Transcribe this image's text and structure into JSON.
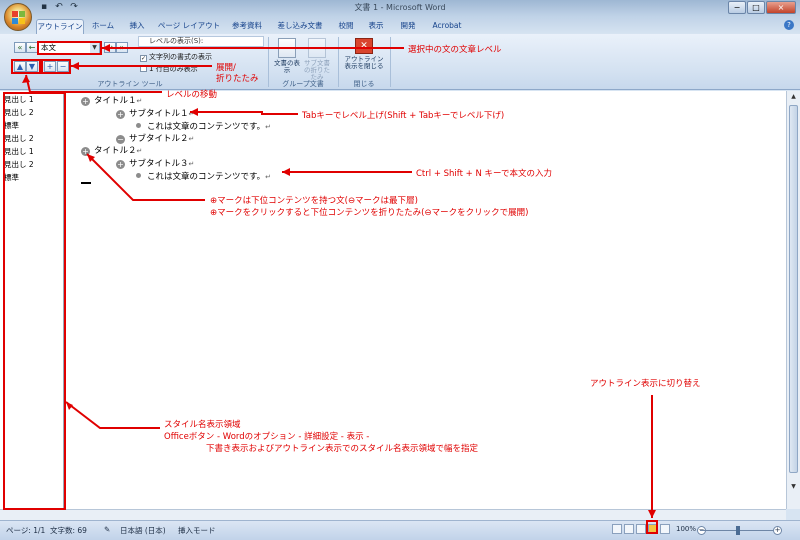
{
  "window": {
    "title": "文書 1 - Microsoft Word",
    "controls": [
      "−",
      "□",
      "×"
    ]
  },
  "quick_access": [
    "save-icon",
    "undo-icon",
    "redo-icon"
  ],
  "tabs": [
    {
      "label": "アウトライン",
      "active": true
    },
    {
      "label": "ホーム"
    },
    {
      "label": "挿入"
    },
    {
      "label": "ページ レイアウト"
    },
    {
      "label": "参考資料"
    },
    {
      "label": "差し込み文書"
    },
    {
      "label": "校閲"
    },
    {
      "label": "表示"
    },
    {
      "label": "開発"
    },
    {
      "label": "Acrobat"
    }
  ],
  "ribbon": {
    "level_value": "本文",
    "show_level": "レベルの表示(S):",
    "show_text_formatting": "文字列の書式の表示",
    "show_first_line_only": "1 行目のみ表示",
    "group_outline_tools": "アウトライン ツール",
    "btn_show_document": "文書の表示",
    "btn_collapse_subdocs": "サブ文書の折りたたみ",
    "group_master_document": "グループ文書",
    "btn_close_outline": "アウトライン表示を閉じる",
    "group_close": "閉じる"
  },
  "style_pane": [
    "見出し 1",
    "見出し 2",
    "標準",
    "見出し 2",
    "見出し 1",
    "見出し 2",
    "標準"
  ],
  "outline": {
    "title1": "タイトル１",
    "subtitle1": "サブタイトル１",
    "body1": "これは文章のコンテンツです。",
    "subtitle2": "サブタイトル２",
    "title2": "タイトル２",
    "subtitle3": "サブタイトル３",
    "body2": "これは文章のコンテンツです。",
    "para_mark": "↵"
  },
  "status": {
    "page": "ページ: 1/1",
    "words": "文字数: 69",
    "language": "日本語 (日本)",
    "mode": "挿入モード",
    "zoom": "100%"
  },
  "annotations": {
    "level_of_selected": "選択中の文の文章レベル",
    "expand_collapse": "展開/\n折りたたみ",
    "expand_line1": "展開/",
    "expand_line2": "折りたたみ",
    "move_level": "レベルの移動",
    "tab_key": "Tabキーでレベル上げ(Shift + Tabキーでレベル下げ)",
    "ctrl_shift_n": "Ctrl + Shift + N キーで本文の入力",
    "plus_mark_line1": "⊕マークは下位コンテンツを持つ文(⊖マークは最下層)",
    "plus_mark_line2": "⊕マークをクリックすると下位コンテンツを折りたたみ(⊖マークをクリックで展開)",
    "switch_outline": "アウトライン表示に切り替え",
    "style_area_line1": "スタイル名表示領域",
    "style_area_line2": "Officeボタン - Wordのオプション - 詳細設定 - 表示 -",
    "style_area_line3": "下書き表示およびアウトライン表示でのスタイル名表示領域で幅を指定"
  },
  "colors": {
    "annotation": "#e00000",
    "ribbon": "#d3e1f1",
    "tab_text": "#15428b"
  }
}
